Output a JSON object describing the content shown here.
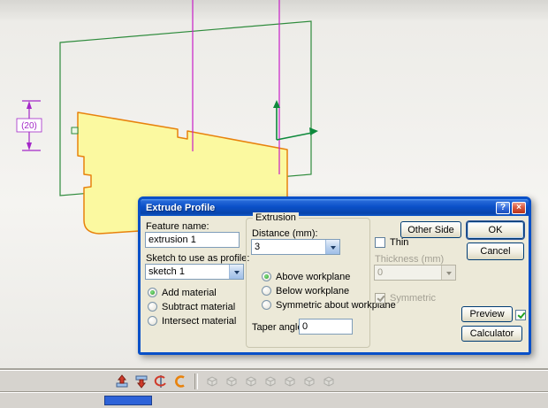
{
  "colors": {
    "dialog-bg": "#ECE9D8",
    "titlebar-blue": "#0B50C8",
    "profile-fill": "#FBF9A0",
    "profile-stroke": "#E8820C",
    "plane-green": "#2E8B3C",
    "axis-green": "#0E8A3C",
    "dimension-purple": "#A428C8",
    "refline-magenta": "#C81EC8",
    "status-blue": "#2E63D8"
  },
  "viewport": {
    "dimension_label": "(20)"
  },
  "dialog": {
    "title": "Extrude Profile",
    "help_button_glyph": "?",
    "close_button_glyph": "×",
    "feature_name": {
      "label": "Feature name:",
      "value": "extrusion 1"
    },
    "sketch_profile": {
      "label": "Sketch to use as profile:",
      "value": "sketch 1"
    },
    "material_options": [
      {
        "label": "Add material",
        "selected": true
      },
      {
        "label": "Subtract material",
        "selected": false
      },
      {
        "label": "Intersect material",
        "selected": false
      }
    ],
    "extrusion": {
      "group_title": "Extrusion",
      "distance": {
        "label": "Distance (mm):",
        "value": "3"
      },
      "direction_options": [
        {
          "label": "Above workplane",
          "selected": true
        },
        {
          "label": "Below workplane",
          "selected": false
        },
        {
          "label": "Symmetric about workplane",
          "selected": false
        }
      ],
      "taper": {
        "label": "Taper angle:",
        "value": "0"
      }
    },
    "other_side_button": "Other Side",
    "ok_button": "OK",
    "cancel_button": "Cancel",
    "thin_checkbox": {
      "label": "Thin",
      "checked": false
    },
    "thickness": {
      "label": "Thickness (mm)",
      "value": "0",
      "disabled": true
    },
    "symmetric_checkbox": {
      "label": "Symmetric",
      "checked": true,
      "disabled": true
    },
    "preview_button": "Preview",
    "preview_checkbox_checked": true,
    "calculator_button": "Calculator"
  },
  "toolbar": {
    "icons": [
      {
        "name": "extrude-boss-icon",
        "enabled": true
      },
      {
        "name": "extrude-cut-icon",
        "enabled": true
      },
      {
        "name": "revolve-icon",
        "enabled": true
      },
      {
        "name": "sweep-icon",
        "enabled": true
      },
      {
        "name": "fillet-icon",
        "enabled": false
      },
      {
        "name": "chamfer-icon",
        "enabled": false
      },
      {
        "name": "shell-icon",
        "enabled": false
      },
      {
        "name": "loft-icon",
        "enabled": false
      },
      {
        "name": "pattern-icon",
        "enabled": false
      },
      {
        "name": "mirror-icon",
        "enabled": false
      },
      {
        "name": "boolean-icon",
        "enabled": false
      }
    ]
  }
}
